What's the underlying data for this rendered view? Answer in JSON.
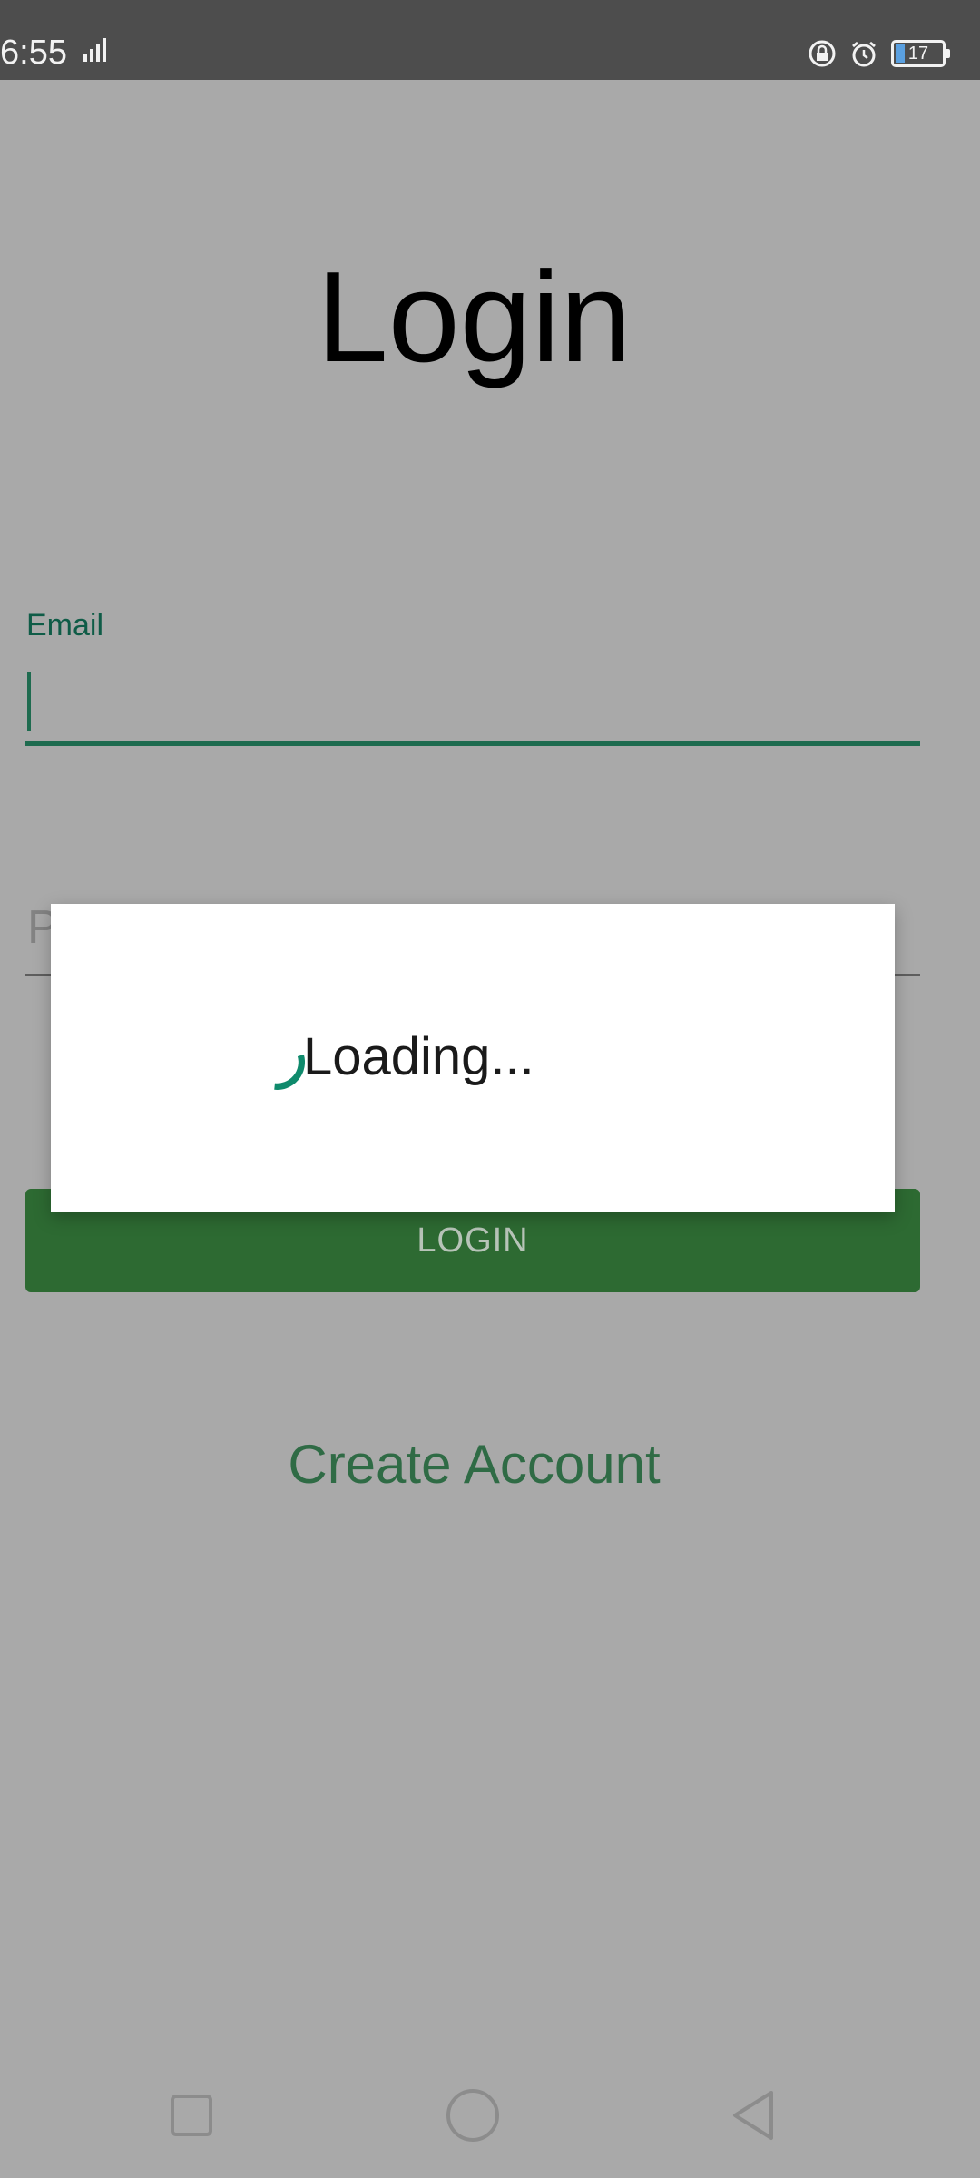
{
  "status_bar": {
    "time": "6:55",
    "battery": "17",
    "icons": [
      "signal-icon",
      "vpn-icon",
      "alarm-icon",
      "battery-icon"
    ]
  },
  "login_screen": {
    "title": "Login",
    "email_label": "Email",
    "email_value": "",
    "password_hint": "P",
    "login_button": "LOGIN",
    "create_account_link": "Create Account"
  },
  "loading_dialog": {
    "text": "Loading...",
    "spinner_color": "#0f8a6c"
  },
  "nav_bar": {
    "buttons": [
      "recent-apps-icon",
      "home-icon",
      "back-icon"
    ]
  },
  "colors": {
    "accent": "#1e6b4f",
    "button": "#2d6a32",
    "scrim_background": "#a9a9a9"
  }
}
